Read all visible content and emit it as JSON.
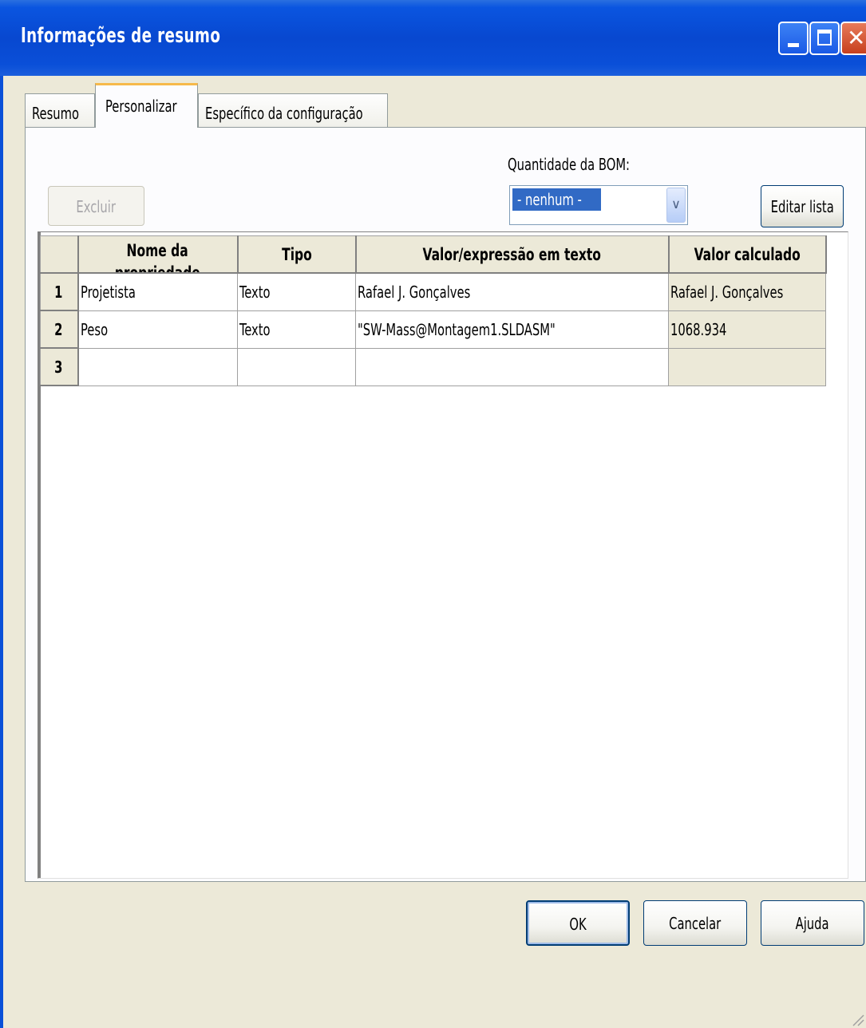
{
  "window": {
    "title": "Informações de resumo"
  },
  "tabs": [
    {
      "label": "Resumo",
      "active": false
    },
    {
      "label": "Personalizar",
      "active": true
    },
    {
      "label": "Específico da configuração",
      "active": false
    }
  ],
  "toolbar": {
    "delete_label": "Excluir",
    "delete_enabled": false,
    "bom_label": "Quantidade da BOM:",
    "bom_value": "- nenhum -",
    "edit_list_label": "Editar lista"
  },
  "grid": {
    "columns": [
      "",
      "Nome da propriedade",
      "Tipo",
      "Valor/expressão em texto",
      "Valor calculado"
    ],
    "column_header_visible": {
      "name_line1": "Nome da",
      "name_line2": "propriedade"
    },
    "rows": [
      {
        "num": "1",
        "name": "Projetista",
        "type": "Texto",
        "value": "Rafael J. Gonçalves",
        "calculated": "Rafael J. Gonçalves"
      },
      {
        "num": "2",
        "name": "Peso",
        "type": "Texto",
        "value": "\"SW-Mass@Montagem1.SLDASM\"",
        "calculated": "1068.934"
      },
      {
        "num": "3",
        "name": "",
        "type": "",
        "value": "",
        "calculated": ""
      }
    ]
  },
  "footer": {
    "ok_label": "OK",
    "cancel_label": "Cancelar",
    "help_label": "Ajuda"
  },
  "colors": {
    "titlebar": "#0848d0",
    "dialog_bg": "#ece9d8",
    "selection": "#316ac5",
    "active_tab_accent": "#f6b94a"
  }
}
